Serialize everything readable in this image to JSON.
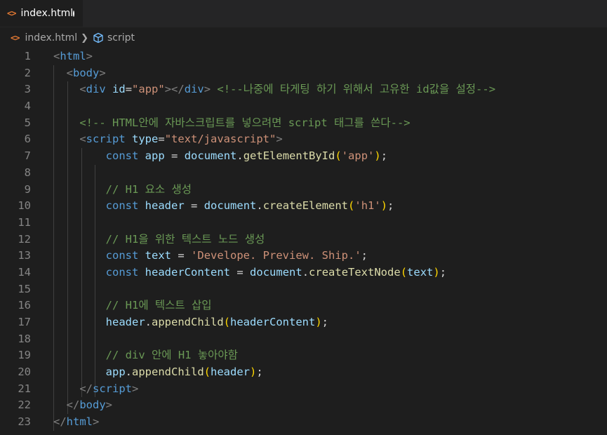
{
  "tab": {
    "filename": "index.html",
    "icon": "<>"
  },
  "breadcrumb": {
    "file": "index.html",
    "symbol": "script"
  },
  "line_numbers": [
    "1",
    "2",
    "3",
    "4",
    "5",
    "6",
    "7",
    "8",
    "9",
    "10",
    "11",
    "12",
    "13",
    "14",
    "15",
    "16",
    "17",
    "18",
    "19",
    "20",
    "21",
    "22",
    "23"
  ],
  "code": {
    "l1_tag": "html",
    "l2_tag": "body",
    "l3_tag": "div",
    "l3_attr": "id",
    "l3_val": "\"app\"",
    "l3_comment": "<!--나중에 타게팅 하기 위해서 고유한 id값을 설정-->",
    "l5_comment": "<!-- HTML안에 자바스크립트를 넣으려면 script 태그를 쓴다-->",
    "l6_tag": "script",
    "l6_attr": "type",
    "l6_val": "\"text/javascript\"",
    "l7_const": "const",
    "l7_var": "app",
    "l7_obj": "document",
    "l7_fn": "getElementById",
    "l7_arg": "'app'",
    "l9_comment": "// H1 요소 생성",
    "l10_const": "const",
    "l10_var": "header",
    "l10_obj": "document",
    "l10_fn": "createElement",
    "l10_arg": "'h1'",
    "l12_comment": "// H1을 위한 텍스트 노드 생성",
    "l13_const": "const",
    "l13_var": "text",
    "l13_val": "'Develope. Preview. Ship.'",
    "l14_const": "const",
    "l14_var": "headerContent",
    "l14_obj": "document",
    "l14_fn": "createTextNode",
    "l14_arg": "text",
    "l16_comment": "// H1에 텍스트 삽입",
    "l17_obj": "header",
    "l17_fn": "appendChild",
    "l17_arg": "headerContent",
    "l19_comment": "// div 안에 H1 놓아야함",
    "l20_obj": "app",
    "l20_fn": "appendChild",
    "l20_arg": "header",
    "l21_tag": "script",
    "l22_tag": "body",
    "l23_tag": "html"
  },
  "colors": {
    "background": "#1e1e1e",
    "tag": "#569cd6",
    "attribute": "#9cdcfe",
    "string": "#ce9178",
    "comment": "#6a9955",
    "function": "#dcdcaa",
    "bracket_level1": "#ffd700",
    "bracket_level2": "#da70d6",
    "html_icon": "#e37933"
  }
}
